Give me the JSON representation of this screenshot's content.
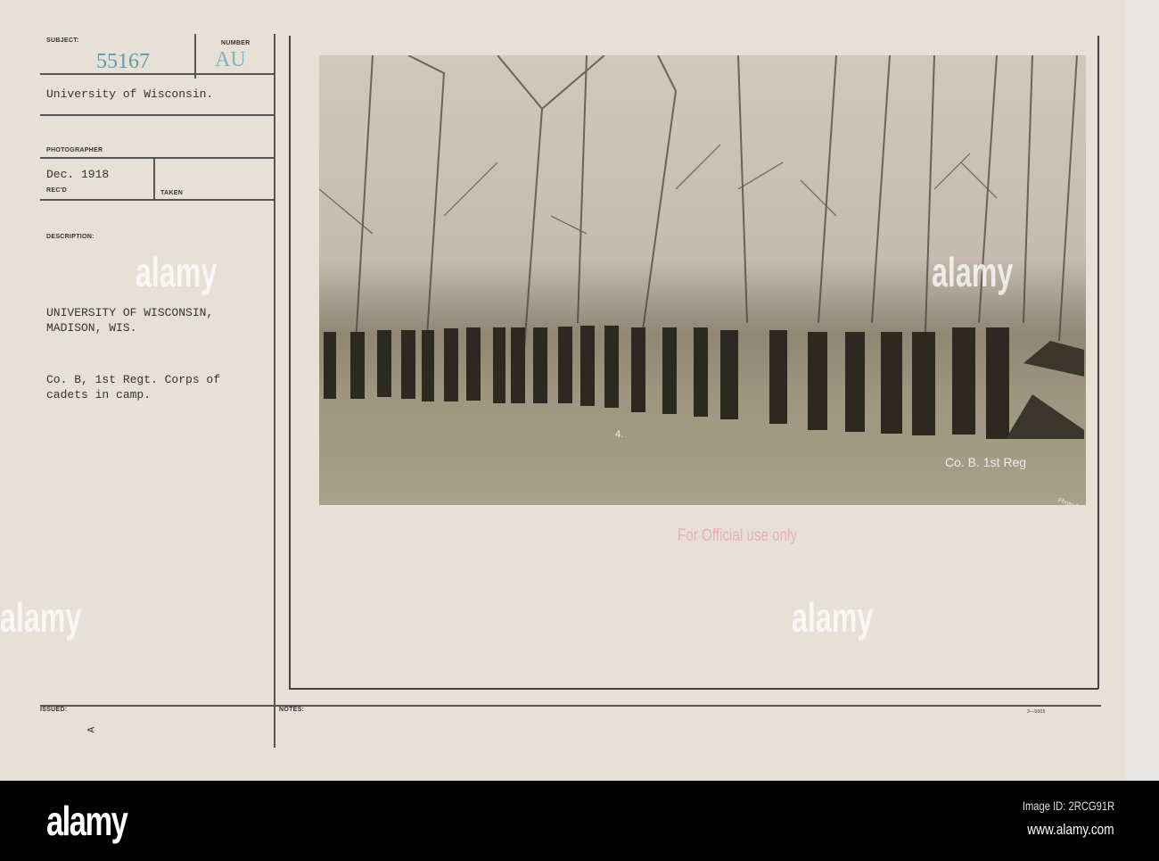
{
  "card": {
    "subject_label": "SUBJECT:",
    "subject_number": "55167",
    "number_label": "NUMBER",
    "number_value": "AU",
    "title": "University of Wisconsin.",
    "photographer_label": "PHOTOGRAPHER",
    "recd_value": "Dec. 1918",
    "recd_label": "REC'D",
    "taken_label": "TAKEN",
    "description_label": "DESCRIPTION:",
    "description_lines": [
      "UNIVERSITY OF WISCONSIN,",
      "MADISON, WIS.",
      "",
      "Co. B, 1st Regt. Corps of",
      "cadets in camp."
    ],
    "issued_label": "ISSUED:",
    "issued_mark": "A",
    "notes_label": "NOTES:",
    "form_number": "3—5005"
  },
  "photo": {
    "caption": "Co. B. 1st Reg",
    "studio_mark": "Photo Art",
    "photo_number": "4.",
    "stamp": "For Official use only"
  },
  "watermark": {
    "text": "alamy",
    "letter": "a"
  },
  "footer": {
    "logo": "alamy",
    "image_id": "Image ID: 2RCG91R",
    "site": "www.alamy.com"
  }
}
